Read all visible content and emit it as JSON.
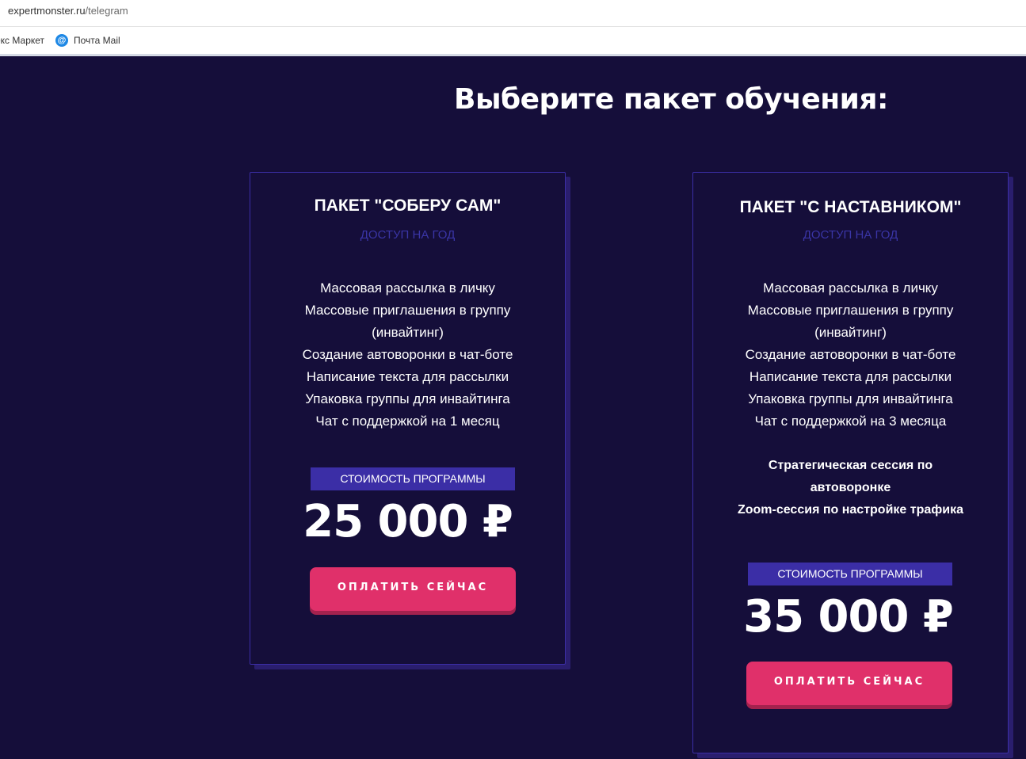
{
  "browser": {
    "url_domain": "expertmonster.ru",
    "url_path": "/telegram",
    "bookmarks": [
      {
        "label": "екс Маркет"
      },
      {
        "label": "Почта Mail"
      }
    ]
  },
  "page": {
    "title": "Выберите пакет обучения:"
  },
  "packages": [
    {
      "title": "ПАКЕТ \"СОБЕРУ САМ\"",
      "subtitle": "ДОСТУП НА ГОД",
      "features": [
        "Массовая рассылка в личку",
        "Массовые приглашения в группу",
        "(инвайтинг)",
        "Создание автоворонки в чат-боте",
        "Написание текста для рассылки",
        "Упаковка группы для инвайтинга",
        "Чат с поддержкой на 1 месяц"
      ],
      "price_label": "СТОИМОСТЬ ПРОГРАММЫ",
      "price": "25 000 ₽",
      "button_label": "ОПЛАТИТЬ СЕЙЧАС"
    },
    {
      "title": "ПАКЕТ \"С НАСТАВНИКОМ\"",
      "subtitle": "ДОСТУП НА ГОД",
      "features": [
        "Массовая рассылка в личку",
        "Массовые приглашения в группу",
        "(инвайтинг)",
        "Создание автоворонки в чат-боте",
        "Написание текста для рассылки",
        "Упаковка группы для инвайтинга",
        "Чат с поддержкой на 3 месяца"
      ],
      "bonus": [
        "Стратегическая сессия по",
        "автоворонке",
        "Zoom-сессия по настройке трафика"
      ],
      "price_label": "СТОИМОСТЬ ПРОГРАММЫ",
      "price": "35 000 ₽",
      "button_label": "ОПЛАТИТЬ СЕЙЧАС"
    }
  ],
  "colors": {
    "background": "#150e3a",
    "card_border": "#3b2ea6",
    "accent": "#e0306a",
    "subtitle": "#3a35a6"
  }
}
